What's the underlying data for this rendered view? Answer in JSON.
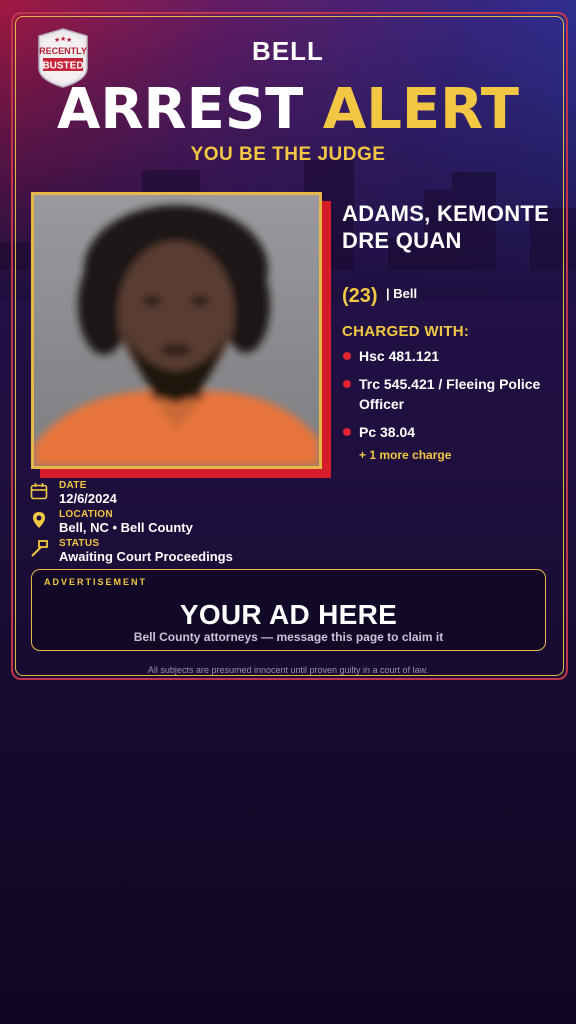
{
  "header": {
    "badge_line1": "RECENTLY",
    "badge_line2": "BUSTED",
    "location": "BELL",
    "title_word1": "ARREST",
    "title_word2": "ALERT",
    "tagline": "YOU BE THE JUDGE"
  },
  "person": {
    "name": "ADAMS, KEMONTE DRE QUAN",
    "age": "(23)",
    "city": "| Bell"
  },
  "charges": {
    "label": "CHARGED WITH:",
    "items": [
      "Hsc 481.121",
      "Trc 545.421 / Fleeing Police Officer",
      "Pc 38.04"
    ],
    "more": "+ 1 more charge"
  },
  "details": {
    "date_label": "DATE",
    "date_value": "12/6/2024",
    "location_label": "LOCATION",
    "location_value": "Bell, NC • Bell County",
    "status_label": "STATUS",
    "status_value": "Awaiting Court Proceedings"
  },
  "ad": {
    "label": "ADVERTISEMENT",
    "title": "YOUR AD HERE",
    "subtitle": "Bell County attorneys — message this page to claim it"
  },
  "footer": {
    "disclaimer": "All subjects are presumed innocent until proven guilty in a court of law."
  },
  "colors": {
    "accent_gold": "#f2c744",
    "accent_red": "#e0242f",
    "background": "#1e0f3e"
  },
  "icons": [
    "badge-logo",
    "calendar-icon",
    "location-pin-icon",
    "gavel-icon"
  ]
}
